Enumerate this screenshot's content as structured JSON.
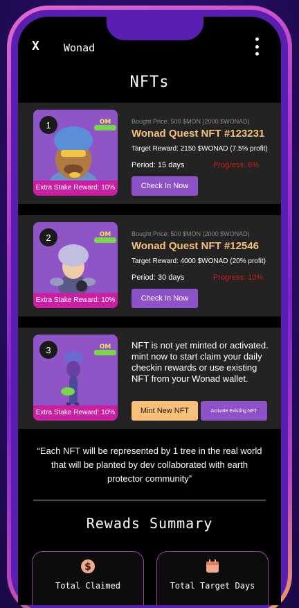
{
  "header": {
    "close_label": "X",
    "app_name": "Wonad"
  },
  "page_title": "NFTs",
  "nfts": [
    {
      "number": "1",
      "bought_price": "Bought Price: 500 $MON (2000 $WONAD)",
      "title": "Wonad Quest  NFT #123231",
      "target_reward": "Target Reward:  2150 $WONAD (7.5% profit)",
      "period": "Period: 15 days",
      "progress": "Progress: 6%",
      "progress_value": 6,
      "stake_reward": "Extra Stake Reward: 10%",
      "checkin_label": "Check In Now"
    },
    {
      "number": "2",
      "bought_price": "Bought Price: 500 $MON (2000 $WONAD)",
      "title": "Wonad Quest  NFT #12546",
      "target_reward": "Target Reward:  4000 $WONAD (20% profit)",
      "period": "Period: 30 days",
      "progress": "Progress: 10%",
      "progress_value": 10,
      "stake_reward": "Extra Stake Reward: 10%",
      "checkin_label": "Check In Now"
    }
  ],
  "mint_card": {
    "number": "3",
    "message": "NFT is not yet minted or activated. mint now to start claim your daily checkin rewards or use existing NFT from your Wonad wallet.",
    "stake_reward": "Extra Stake Reward: 10%",
    "mint_label": "Mint New NFT",
    "activate_label": "Activate Existing NFT"
  },
  "quote": "“Each NFT will be represented by 1 tree in the real world that will be planted by dev collaborated with earth protector community”",
  "rewards": {
    "title": "Rewads  Summary",
    "cards": [
      {
        "label": "Total Claimed",
        "icon": "dollar-coin-icon"
      },
      {
        "label": "Total Target Days",
        "icon": "calendar-icon"
      }
    ]
  },
  "colors": {
    "accent_purple": "#8d52c7",
    "title_gold": "#f7c27a",
    "stake_magenta": "#c91fa2",
    "progress_red": "#d41a1a",
    "mint_orange": "#f9c07a"
  }
}
